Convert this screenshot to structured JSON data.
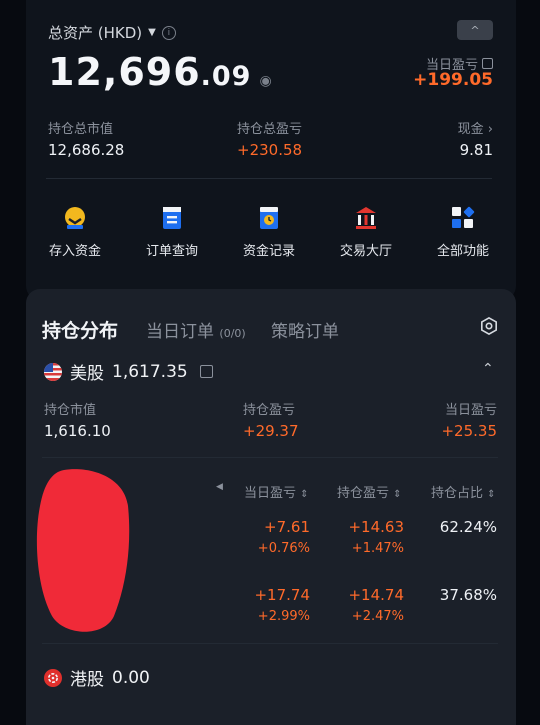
{
  "header": {
    "asset_title": "总资产 (HKD)",
    "total_int": "12,696",
    "total_dec": ".09",
    "today_pl_label": "当日盈亏",
    "today_pl_value": "+199.05",
    "collapse_icon": "^"
  },
  "stats": [
    {
      "label": "持仓总市值",
      "value": "12,686.28"
    },
    {
      "label": "持仓总盈亏",
      "value": "+230.58"
    },
    {
      "label": "现金",
      "value": "9.81"
    }
  ],
  "actions": [
    {
      "label": "存入资金",
      "icon": "deposit-icon"
    },
    {
      "label": "订单查询",
      "icon": "order-query-icon"
    },
    {
      "label": "资金记录",
      "icon": "funds-record-icon"
    },
    {
      "label": "交易大厅",
      "icon": "trading-hall-icon"
    },
    {
      "label": "全部功能",
      "icon": "all-functions-icon"
    }
  ],
  "panel": {
    "tabs": [
      {
        "label": "持仓分布"
      },
      {
        "label": "当日订单",
        "count": "(0/0)"
      },
      {
        "label": "策略订单"
      }
    ],
    "us_market": {
      "name": "美股",
      "value": "1,617.35",
      "summary": [
        {
          "label": "持仓市值",
          "value": "1,616.10"
        },
        {
          "label": "持仓盈亏",
          "value": "+29.37"
        },
        {
          "label": "当日盈亏",
          "value": "+25.35"
        }
      ]
    },
    "table_headers": [
      "当日盈亏",
      "持仓盈亏",
      "持仓占比"
    ],
    "rows": [
      {
        "today_pl": "+7.61",
        "today_pct": "+0.76%",
        "hold_pl": "+14.63",
        "hold_pct": "+1.47%",
        "ratio": "62.24%"
      },
      {
        "today_pl": "+17.74",
        "today_pct": "+2.99%",
        "hold_pl": "+14.74",
        "hold_pct": "+2.47%",
        "ratio": "37.68%"
      }
    ],
    "hk_market": {
      "name": "港股",
      "value": "0.00"
    }
  },
  "colors": {
    "accent_orange": "#ff6a2a",
    "brand_blue": "#1e6ff0"
  }
}
